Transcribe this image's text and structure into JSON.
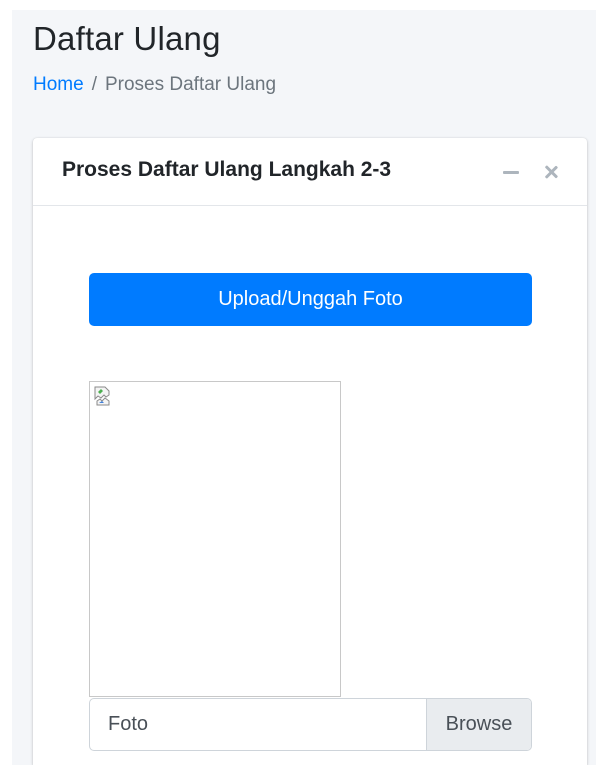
{
  "header": {
    "title": "Daftar Ulang",
    "breadcrumb": {
      "home": "Home",
      "separator": "/",
      "current": "Proses Daftar Ulang"
    }
  },
  "card": {
    "title": "Proses Daftar Ulang Langkah 2-3",
    "tools": {
      "collapse_icon": "minus-icon",
      "remove_icon": "close-icon"
    },
    "upload_button_label": "Upload/Unggah Foto",
    "photo_preview_icon": "broken-image-icon",
    "file_input": {
      "label": "Foto",
      "browse_label": "Browse"
    }
  },
  "colors": {
    "primary": "#007bff",
    "page_background": "#f4f6f9",
    "muted": "#6c757d",
    "tool_icon": "#adb5bd"
  }
}
